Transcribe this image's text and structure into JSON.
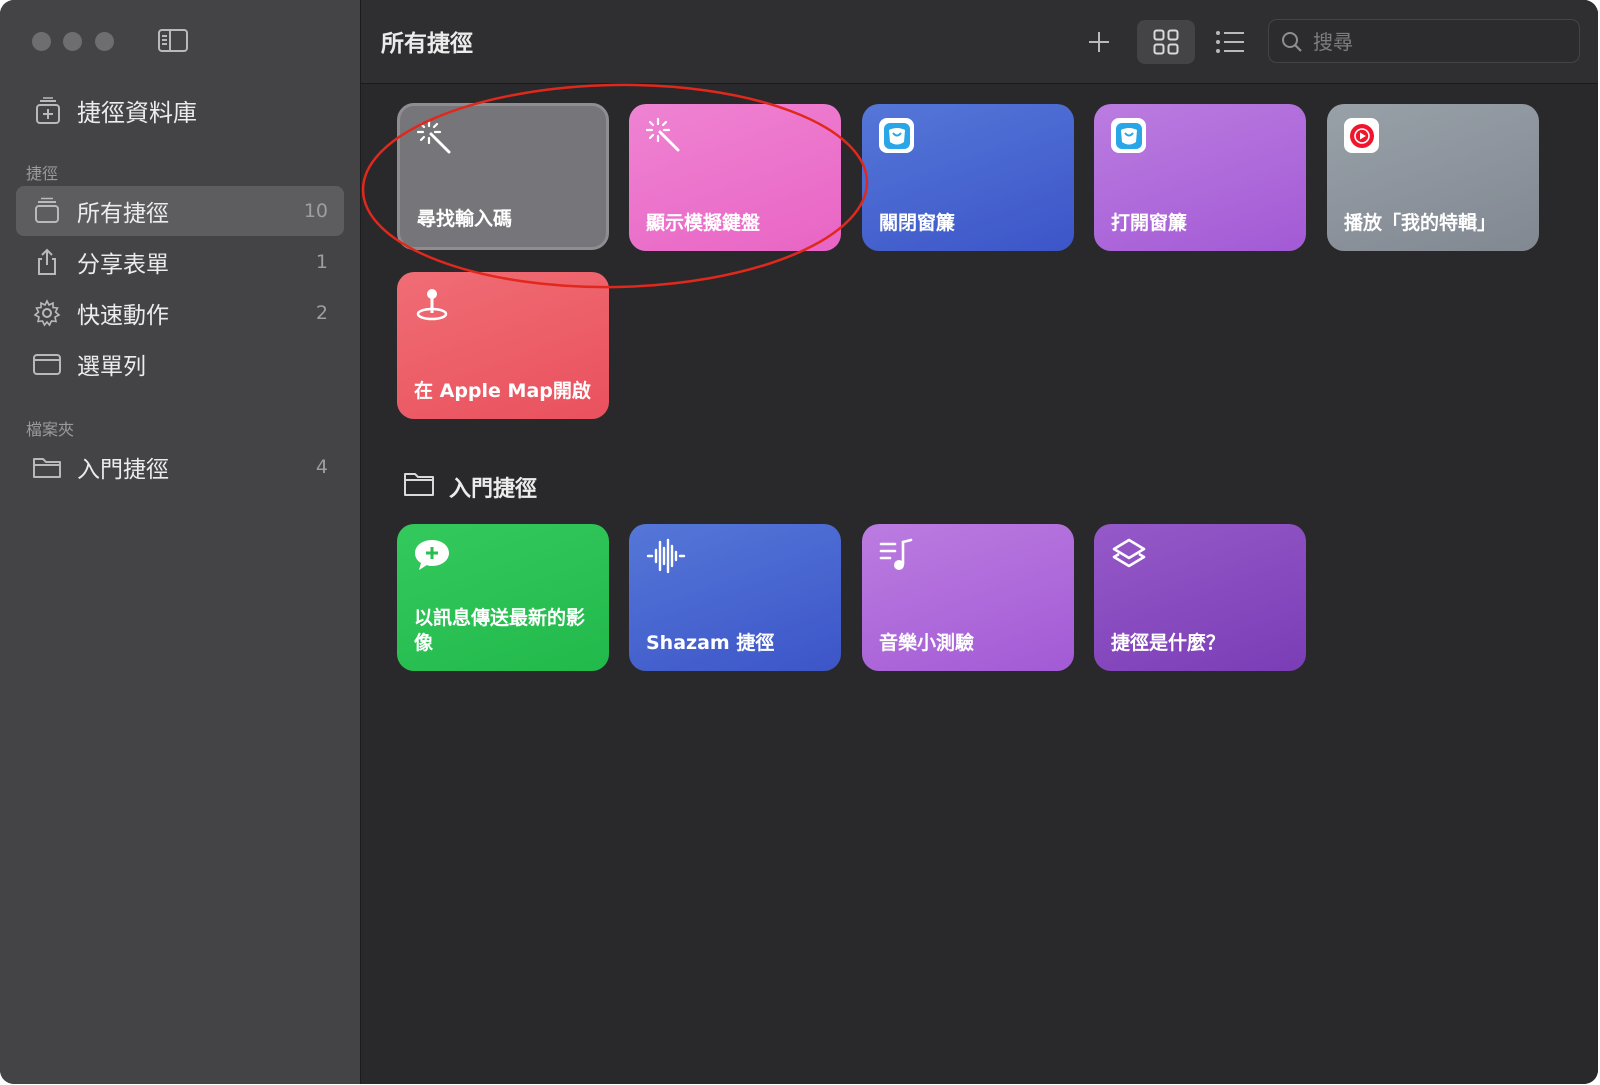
{
  "sidebar": {
    "library_label": "捷徑資料庫",
    "section_shortcuts": "捷徑",
    "section_folders": "檔案夾",
    "items": [
      {
        "label": "所有捷徑",
        "count": "10"
      },
      {
        "label": "分享表單",
        "count": "1"
      },
      {
        "label": "快速動作",
        "count": "2"
      },
      {
        "label": "選單列",
        "count": ""
      }
    ],
    "folders": [
      {
        "label": "入門捷徑",
        "count": "4"
      }
    ]
  },
  "toolbar": {
    "title": "所有捷徑",
    "add_icon": "plus-icon",
    "grid_view_icon": "grid-icon",
    "list_view_icon": "list-icon",
    "search_placeholder": "搜尋"
  },
  "shortcuts": [
    {
      "label": "尋找輸入碼",
      "icon": "magic-wand-icon",
      "color": "#76767a",
      "selected": true
    },
    {
      "label": "顯示模擬鍵盤",
      "icon": "magic-wand-icon",
      "color": "#ee7bcd"
    },
    {
      "label": "關閉窗簾",
      "icon": "smart-home-app-icon",
      "color": "#4a67d3"
    },
    {
      "label": "打開窗簾",
      "icon": "smart-home-app-icon",
      "color": "#b06fdc"
    },
    {
      "label": "播放「我的特輯」",
      "icon": "youtube-music-app-icon",
      "color": "#8c939c"
    },
    {
      "label": "在 Apple Map開啟",
      "icon": "map-pin-icon",
      "color": "#ee5b66"
    }
  ],
  "folder_section": {
    "title": "入門捷徑",
    "shortcuts": [
      {
        "label": "以訊息傳送最新的影像",
        "icon": "message-plus-icon",
        "color": "#2ec55a"
      },
      {
        "label": "Shazam 捷徑",
        "icon": "waveform-icon",
        "color": "#4a67d3"
      },
      {
        "label": "音樂小測驗",
        "icon": "music-list-icon",
        "color": "#b06fdc"
      },
      {
        "label": "捷徑是什麼？",
        "icon": "shortcuts-layers-icon",
        "color": "#8c50c2"
      }
    ]
  },
  "annotation": {
    "color": "#e0281c"
  }
}
